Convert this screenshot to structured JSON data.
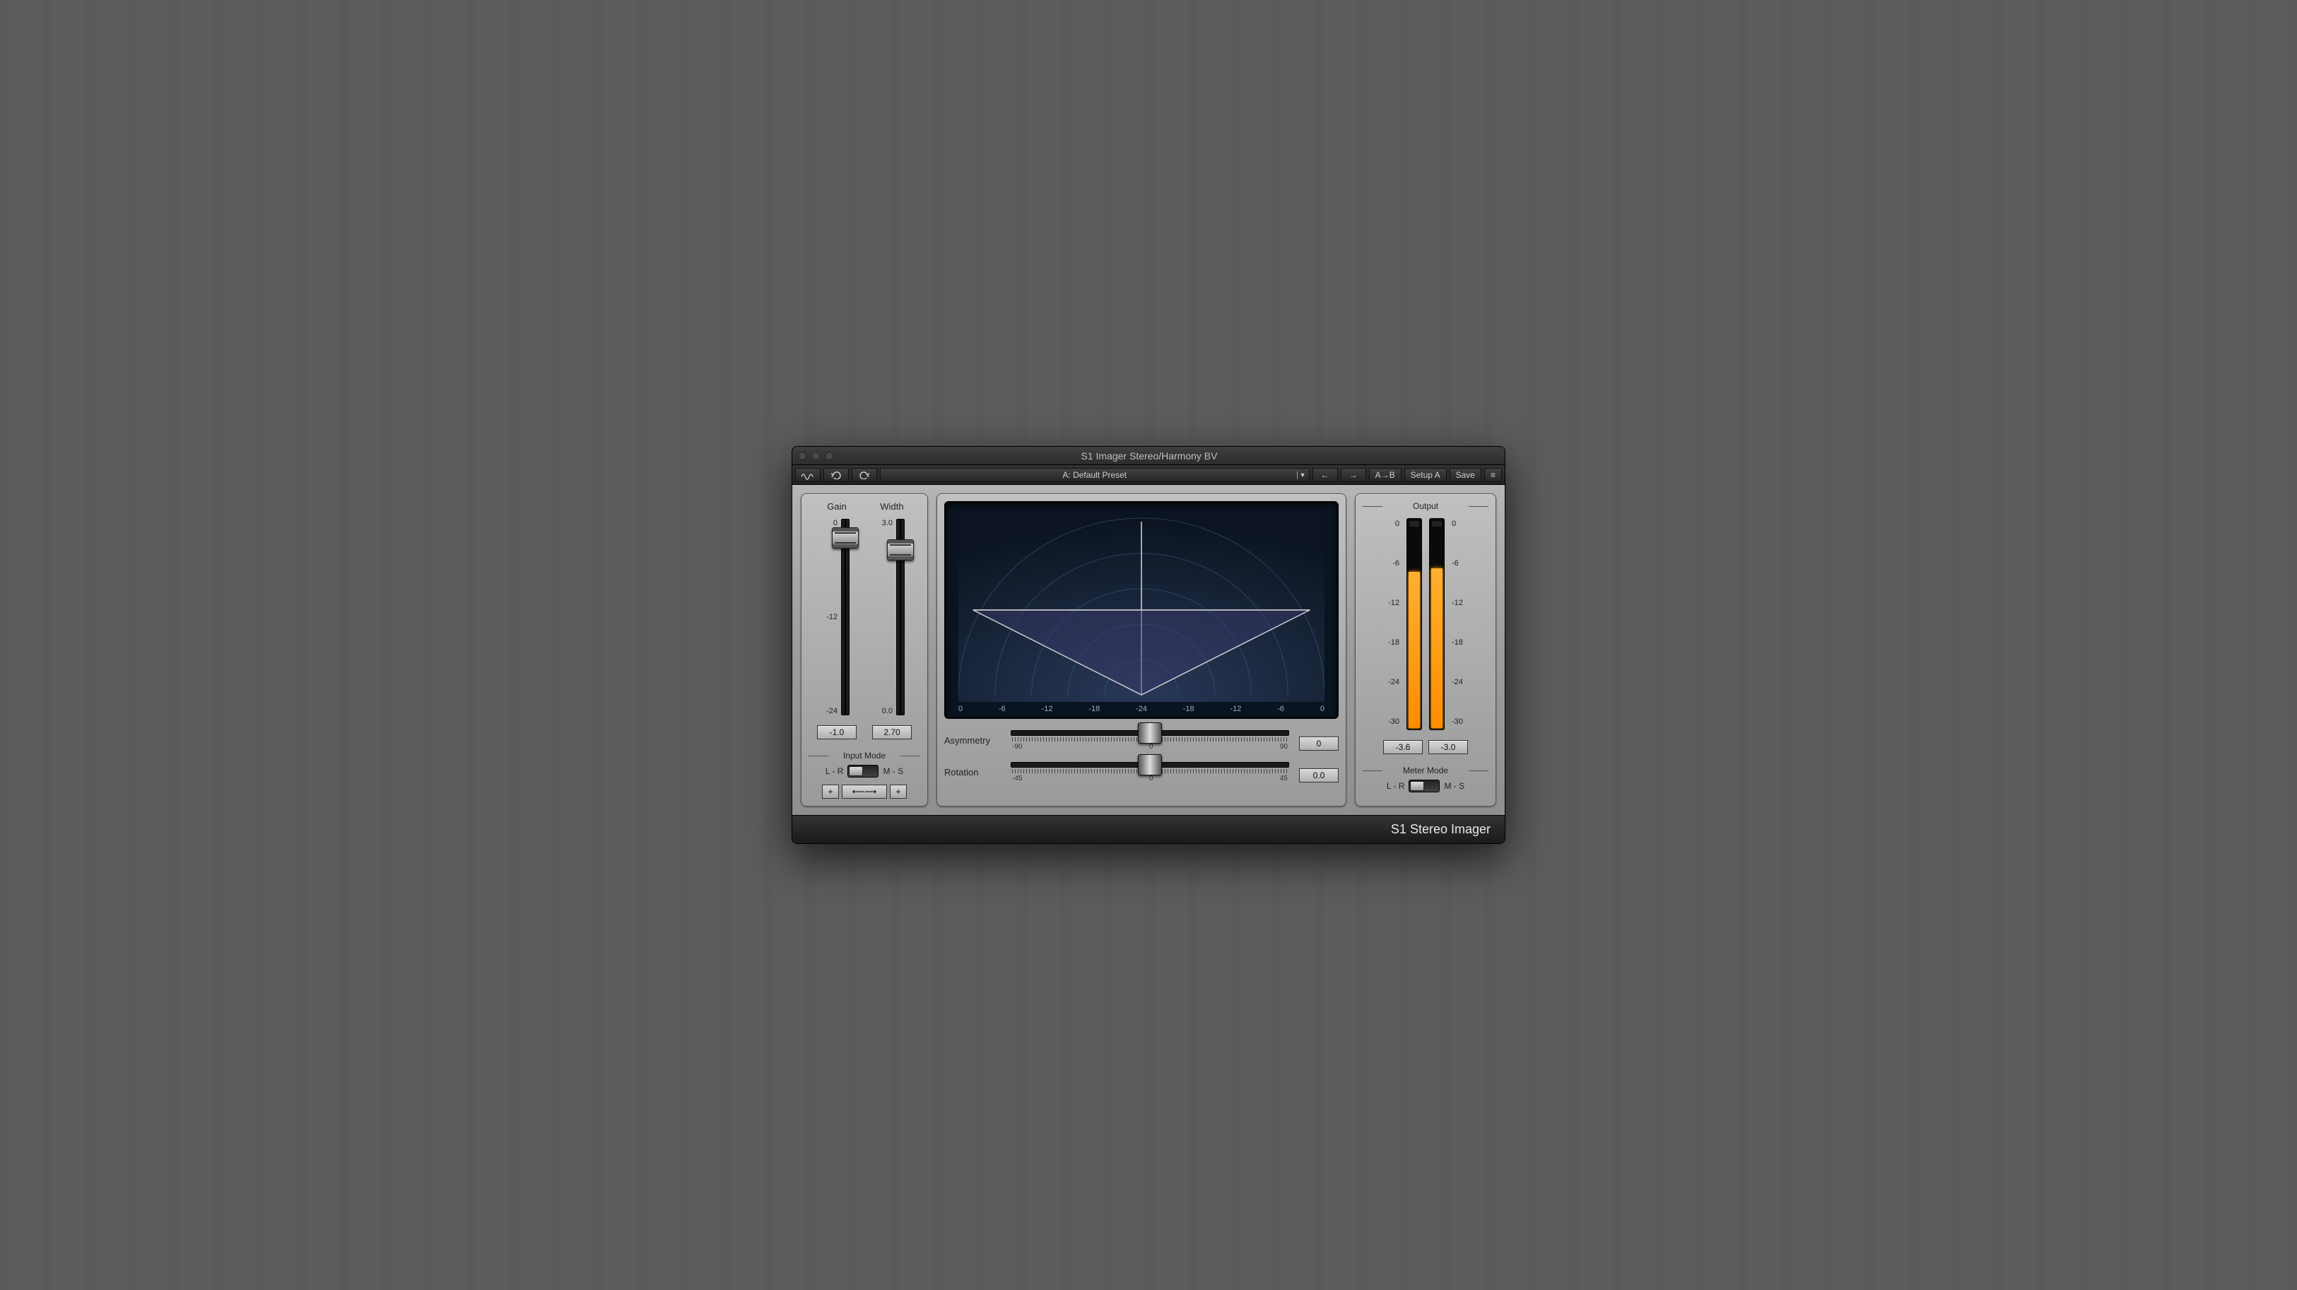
{
  "window_title": "S1 Imager Stereo/Harmony BV",
  "toolbar": {
    "preset": "A: Default Preset",
    "ab": "A→B",
    "setup": "Setup A",
    "save": "Save"
  },
  "gain": {
    "label": "Gain",
    "scale": [
      "0",
      "-12",
      "-24"
    ],
    "value": "-1.0",
    "cap_pct": 4
  },
  "width": {
    "label": "Width",
    "scale": [
      "3.0",
      "",
      "0.0"
    ],
    "value": "2.70",
    "cap_pct": 10
  },
  "input_mode": {
    "label": "Input Mode",
    "left": "L - R",
    "right": "M - S",
    "state": "left"
  },
  "scope": {
    "ticks": [
      "0",
      "-6",
      "-12",
      "-18",
      "-24",
      "-18",
      "-12",
      "-6",
      "0"
    ]
  },
  "asymmetry": {
    "label": "Asymmetry",
    "value": "0",
    "scale": [
      "-90",
      "0",
      "90"
    ],
    "cap_pct": 50
  },
  "rotation": {
    "label": "Rotation",
    "value": "0.0",
    "scale": [
      "-45",
      "0",
      "45"
    ],
    "cap_pct": 50
  },
  "output": {
    "label": "Output",
    "scale": [
      "0",
      "-6",
      "-12",
      "-18",
      "-24",
      "-30"
    ],
    "left_value": "-3.6",
    "right_value": "-3.0",
    "left_fill_pct": 74,
    "right_fill_pct": 76
  },
  "meter_mode": {
    "label": "Meter Mode",
    "left": "L - R",
    "right": "M - S",
    "state": "left"
  },
  "footer": "S1 Stereo Imager"
}
